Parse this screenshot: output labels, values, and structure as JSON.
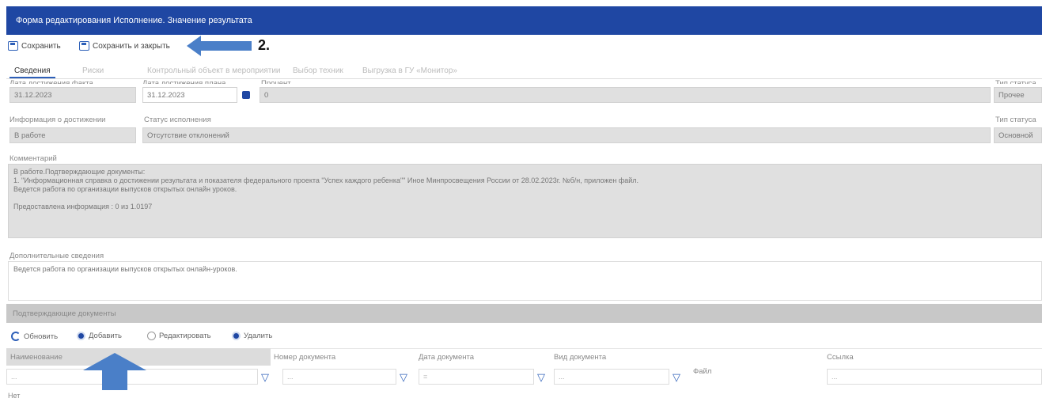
{
  "window": {
    "title": "Форма редактирования Исполнение. Значение результата"
  },
  "toolbar": {
    "save_label": "Сохранить",
    "save_close_label": "Сохранить и закрыть",
    "step_annotation": "2."
  },
  "tabs": [
    "Сведения",
    "Риски",
    "Контрольный объект в мероприятии",
    "Выбор техник",
    "Выгрузка в ГУ «Монитор»"
  ],
  "form": {
    "row1": {
      "fact_date_label": "Дата достижения факта",
      "fact_date_value": "31.12.2023",
      "plan_date_label": "Дата достижения плана",
      "plan_date_value": "31.12.2023",
      "value_label": "Процент",
      "value_value": "0",
      "right_label": "Тип статуса",
      "right_value": "Прочее"
    },
    "row2": {
      "info_label": "Информация о достижении",
      "info_value": "В работе",
      "status_label": "Статус исполнения",
      "status_value": "Отсутствие отклонений",
      "type_label": "Тип статуса",
      "type_value": "Основной"
    },
    "comment_label": "Комментарий",
    "comment_lines": [
      "В работе.Подтверждающие документы:",
      "1. \"Информационная справка о достижении результата и показателя федерального проекта \"Успех каждого ребенка\"\" Иное Минпросвещения России от 28.02.2023г. №б/н, приложен файл.",
      "Ведется работа по организации выпусков открытых онлайн уроков.",
      "",
      "Предоставлена информация : 0 из 1.0197"
    ],
    "extra_label": "Дополнительные сведения",
    "extra_value": "Ведется работа по организации выпусков открытых онлайн-уроков."
  },
  "documents": {
    "header": "Подтверждающие документы",
    "toolbar": {
      "refresh": "Обновить",
      "add": "Добавить",
      "edit": "Редактировать",
      "delete": "Удалить"
    },
    "columns": [
      "Наименование",
      "Номер документа",
      "Дата документа",
      "Вид документа",
      "Файл",
      "Ссылка"
    ],
    "filter_placeholders": [
      "...",
      "...",
      "=",
      "...",
      "..."
    ],
    "rows": [
      "Нет"
    ]
  },
  "colors": {
    "titlebar": "#1f47a3",
    "accent": "#2d5fb8",
    "arrow": "#4a7fc8"
  },
  "icons": {
    "save": "save-disk-icon",
    "calendar": "calendar-icon",
    "refresh": "refresh-icon",
    "filter": "filter-funnel-icon"
  }
}
